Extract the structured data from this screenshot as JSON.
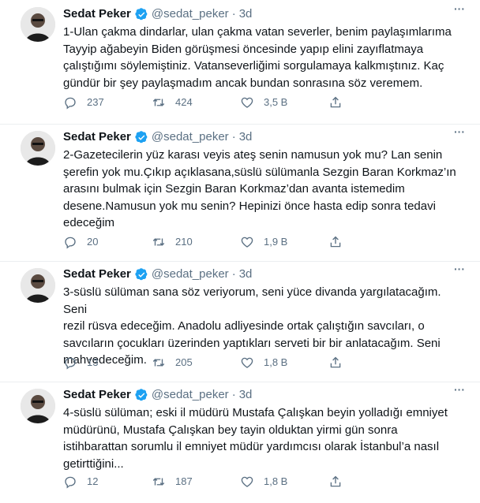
{
  "tweets": [
    {
      "name": "Sedat Peker",
      "handle": "@sedat_peker",
      "dot": "·",
      "time": "3d",
      "lines": [
        "1-Ulan çakma dindarlar, ulan çakma vatan severler, benim paylaşımlarıma",
        "Tayyip ağabeyin Biden görüşmesi öncesinde yapıp elini zayıflatmaya",
        "çalıştığımı söylemiştiniz. Vatanseverliğimi sorgulamaya kalkmıştınız. Kaç",
        "gündür bir şey paylaşmadım ancak bundan sonrasına söz veremem."
      ],
      "replies": "237",
      "retweets": "424",
      "likes": "3,5 B"
    },
    {
      "name": "Sedat Peker",
      "handle": "@sedat_peker",
      "dot": "·",
      "time": "3d",
      "lines": [
        "2-Gazetecilerin yüz karası veyis ateş senin namusun yok mu? Lan senin",
        "şerefin yok mu.Çıkıp açıklasana,süslü sülümanla Sezgin Baran Korkmaz’ın",
        "arasını bulmak için Sezgin Baran Korkmaz’dan avanta istemedim",
        "desene.Namusun yok mu senin? Hepinizi önce hasta edip sonra tedavi",
        "edeceğim"
      ],
      "replies": "20",
      "retweets": "210",
      "likes": "1,9 B"
    },
    {
      "name": "Sedat Peker",
      "handle": "@sedat_peker",
      "dot": "·",
      "time": "3d",
      "lines": [
        "3-süslü sülüman sana söz veriyorum, seni yüce divanda yargılatacağım. Seni",
        "rezil rüsva edeceğim. Anadolu adliyesinde ortak çalıştığın savcıları, o",
        "savcıların çocukları üzerinden yaptıkları serveti bir bir anlatacağım. Seni",
        "mahvedeceğim."
      ],
      "replies": "13",
      "retweets": "205",
      "likes": "1,8 B"
    },
    {
      "name": "Sedat Peker",
      "handle": "@sedat_peker",
      "dot": "·",
      "time": "3d",
      "lines": [
        "4-süslü sülüman; eski il müdürü Mustafa Çalışkan beyin yolladığı emniyet",
        "müdürünü, Mustafa Çalışkan bey tayin olduktan yirmi gün sonra",
        "istihbarattan sorumlu il emniyet müdür yardımcısı olarak İstanbul’a nasıl",
        "getirttiğini..."
      ],
      "replies": "12",
      "retweets": "187",
      "likes": "1,8 B"
    }
  ],
  "icons": {
    "verified": "verified-badge-icon",
    "more": "more-options-icon",
    "reply": "reply-icon",
    "retweet": "retweet-icon",
    "like": "heart-icon",
    "share": "share-icon"
  },
  "colors": {
    "accent": "#1da1f2",
    "muted": "#5b7083",
    "divider": "#ebeef0"
  }
}
